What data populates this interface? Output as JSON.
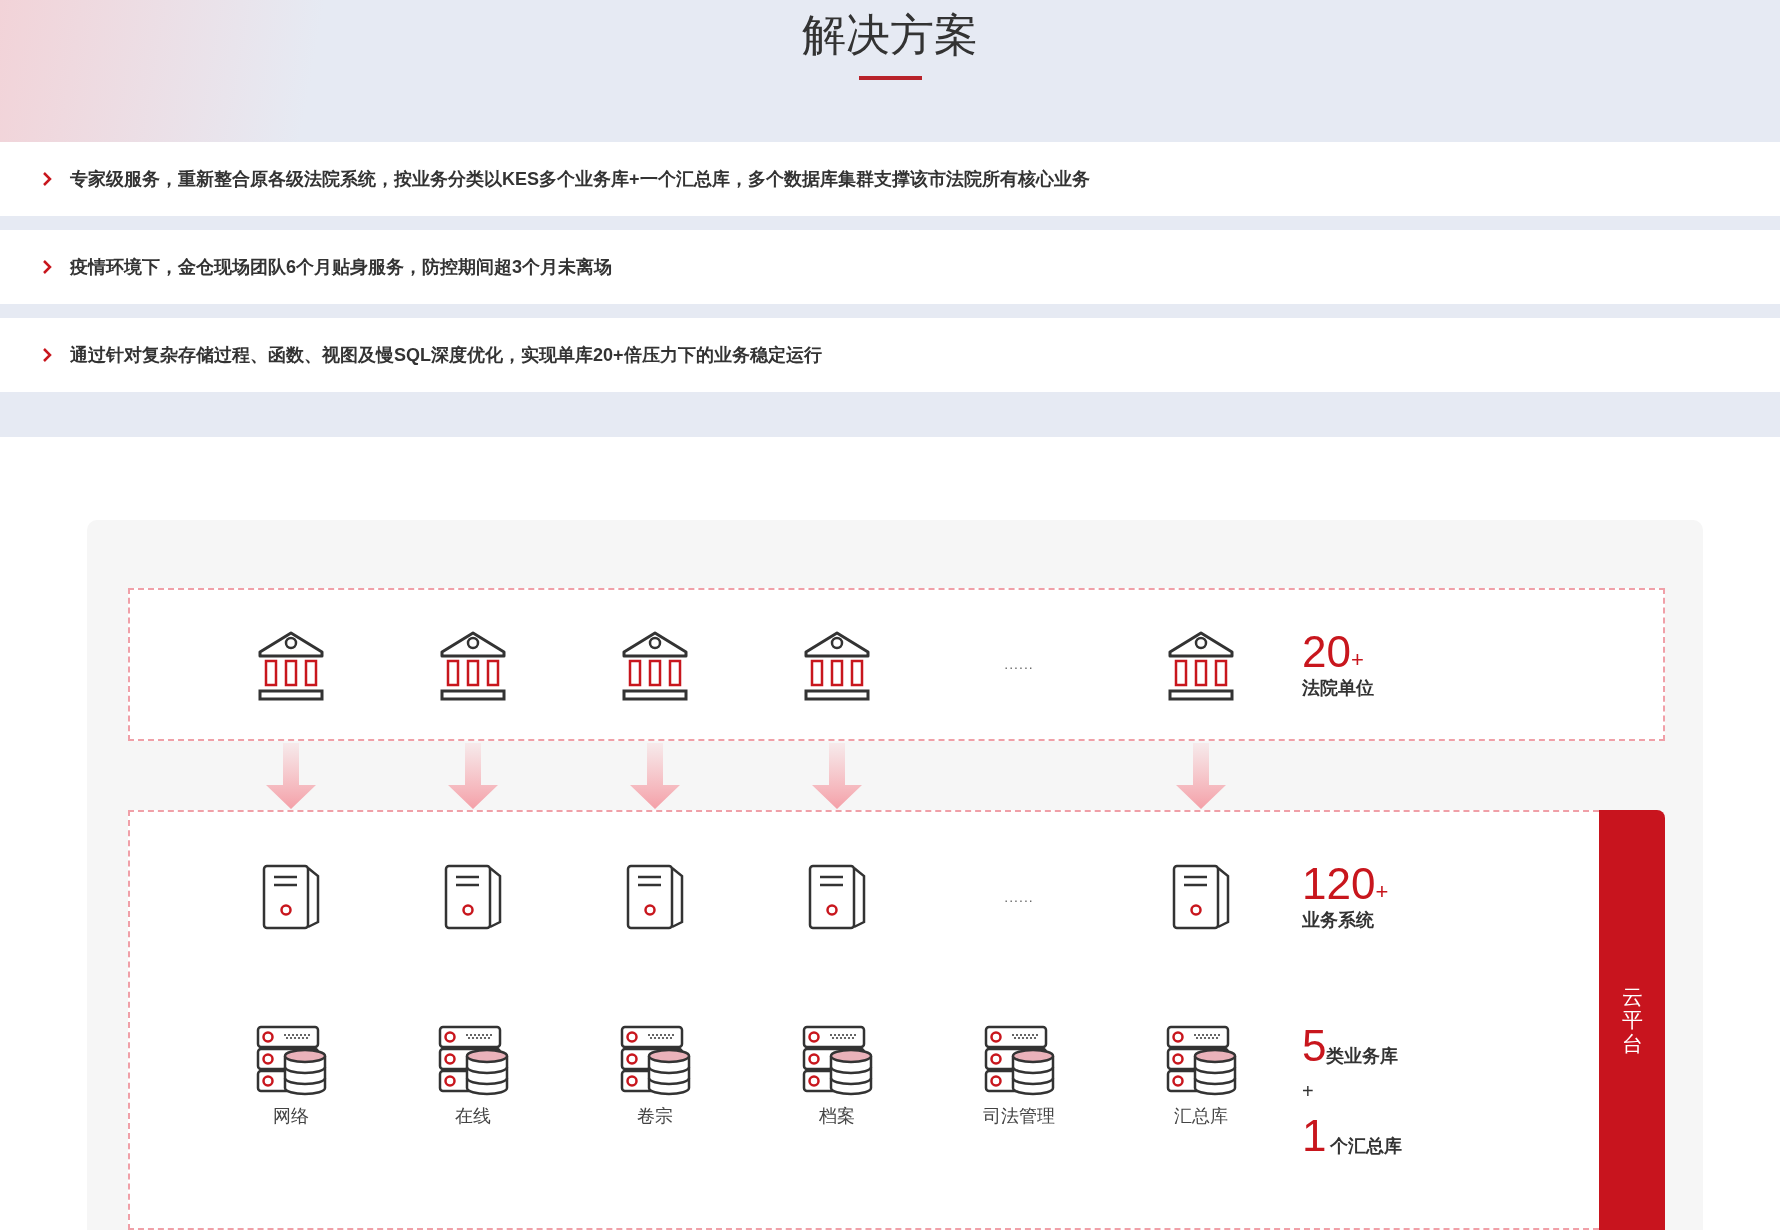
{
  "title": "解决方案",
  "points": [
    {
      "text": "专家级服务，重新整合原各级法院系统，按业务分类以KES多个业务库+一个汇总库，多个数据库集群支撑该市法院所有核心业务"
    },
    {
      "text": "疫情环境下，金仓现场团队6个月贴身服务，防控期间超3个月未离场"
    },
    {
      "text": "通过针对复杂存储过程、函数、视图及慢SQL深度优化，实现单库20+倍压力下的业务稳定运行"
    }
  ],
  "courts": {
    "items": [
      {
        "kind": "court"
      },
      {
        "kind": "court"
      },
      {
        "kind": "court"
      },
      {
        "kind": "court"
      },
      {
        "kind": "ellipsis",
        "text": "......"
      },
      {
        "kind": "court"
      }
    ],
    "stat": {
      "number": "20",
      "plus": "+",
      "label": "法院单位"
    }
  },
  "systems": {
    "items": [
      {
        "kind": "server"
      },
      {
        "kind": "server"
      },
      {
        "kind": "server"
      },
      {
        "kind": "server"
      },
      {
        "kind": "ellipsis",
        "text": "......"
      },
      {
        "kind": "server"
      }
    ],
    "stat": {
      "number": "120",
      "plus": "+",
      "label": "业务系统"
    }
  },
  "databases": {
    "items": [
      {
        "label": "网络"
      },
      {
        "label": "在线"
      },
      {
        "label": "卷宗"
      },
      {
        "label": "档案"
      },
      {
        "label": "司法管理"
      },
      {
        "label": "汇总库"
      }
    ],
    "stat": {
      "number_1": "5",
      "label_1": "类业务库",
      "joiner": "+",
      "number_2": "1",
      "label_2": "个汇总库"
    }
  },
  "side_bar": {
    "label": "云平台"
  }
}
